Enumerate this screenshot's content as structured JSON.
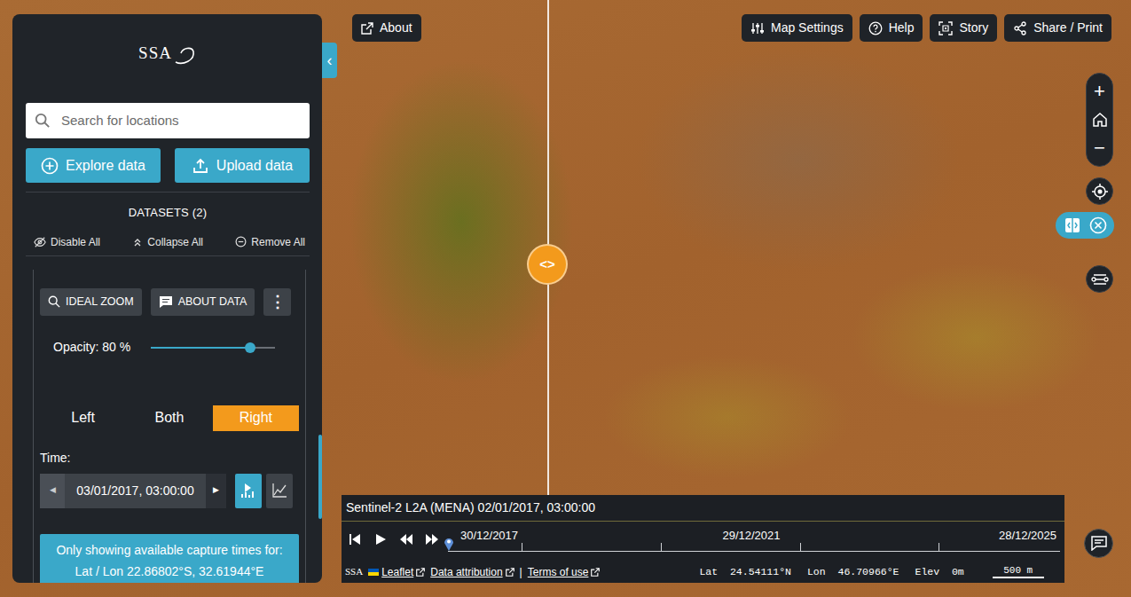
{
  "panel": {
    "collapse": "‹",
    "logo": "SSA",
    "search": {
      "placeholder": "Search for locations"
    },
    "actions": [
      {
        "label": "Explore data"
      },
      {
        "label": "Upload data"
      }
    ],
    "datasets": {
      "title": "DATASETS (2)",
      "tools": [
        {
          "label": "Disable All"
        },
        {
          "label": "Collapse All"
        },
        {
          "label": "Remove All"
        }
      ]
    },
    "dataset": {
      "buttons": [
        {
          "label": "IDEAL ZOOM"
        },
        {
          "label": "ABOUT DATA"
        },
        {
          "label": "⋮"
        }
      ],
      "opacity": {
        "label": "Opacity: 80 %",
        "level": 0.8
      },
      "sides": [
        {
          "label": "Left",
          "selected": false
        },
        {
          "label": "Both",
          "selected": false
        },
        {
          "label": "Right",
          "selected": true
        }
      ],
      "time": {
        "label": "Time:",
        "prev": "◀",
        "value": "03/01/2017, 03:00:00",
        "next": "▶"
      },
      "notice": [
        "Only showing available capture times for:",
        "Lat / Lon 22.86802°S, 32.61944°E"
      ]
    }
  },
  "topbar": {
    "about": "About",
    "buttons": [
      {
        "label": "Map Settings"
      },
      {
        "label": "Help"
      },
      {
        "label": "Story"
      },
      {
        "label": "Share / Print"
      }
    ]
  },
  "map_controls": {
    "zoom_in": "+",
    "zoom_out": "−",
    "compare_on": true
  },
  "split_handle": "<>",
  "timeline": {
    "title": "Sentinel-2 L2A (MENA) 02/01/2017, 03:00:00",
    "dates": [
      "30/12/2017",
      "29/12/2021",
      "28/12/2025"
    ],
    "level": 0.0
  },
  "footer": {
    "logo": "SSA",
    "links": [
      "Leaflet",
      "Data attribution",
      "Terms of use"
    ],
    "separator": "|",
    "lat": "Lat  24.54111°N",
    "lon": "Lon  46.70966°E",
    "elev": "Elev  0m",
    "scale": "500 m"
  }
}
